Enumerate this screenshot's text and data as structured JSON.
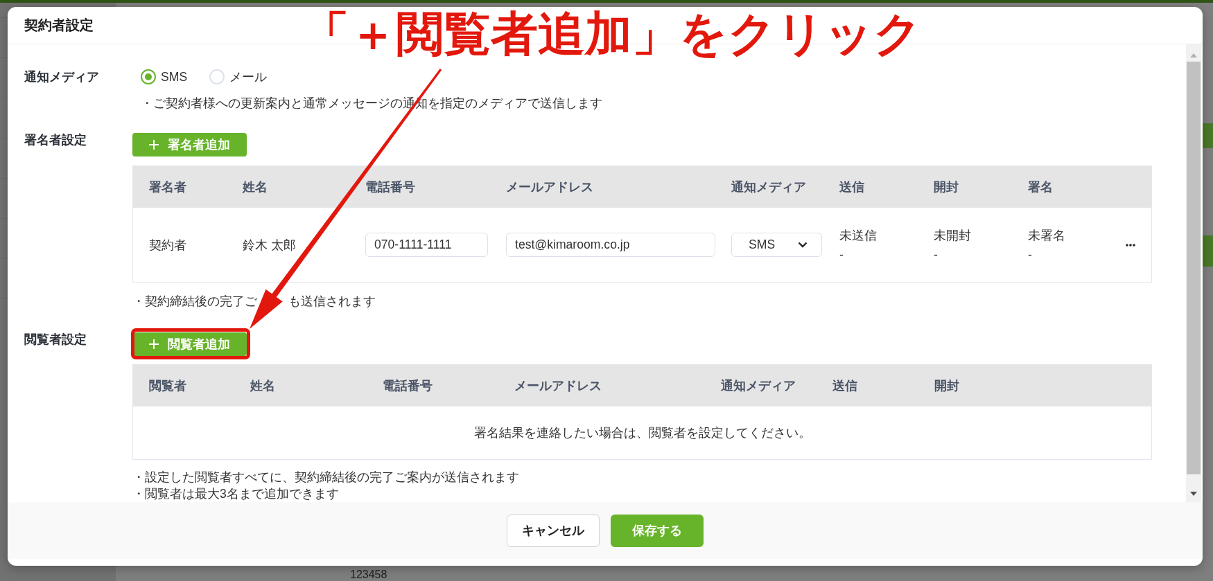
{
  "background_page": {
    "cell_text": "123458"
  },
  "dialog": {
    "title": "契約者設定"
  },
  "notification_media": {
    "label": "通知メディア",
    "options": [
      {
        "label": "SMS",
        "selected": true
      },
      {
        "label": "メール",
        "selected": false
      }
    ],
    "note": "・ご契約者様への更新案内と通常メッセージの通知を指定のメディアで送信します"
  },
  "signers": {
    "label": "署名者設定",
    "add_button": "署名者追加",
    "columns": [
      "署名者",
      "姓名",
      "電話番号",
      "メールアドレス",
      "通知メディア",
      "送信",
      "開封",
      "署名"
    ],
    "rows": [
      {
        "role": "契約者",
        "name": "鈴木 太郎",
        "phone": "070-1111-1111",
        "email": "test@kimaroom.co.jp",
        "media": "SMS",
        "statuses": [
          {
            "status": "未送信",
            "date": "-"
          },
          {
            "status": "未開封",
            "date": "-"
          },
          {
            "status": "未署名",
            "date": "-"
          }
        ]
      }
    ],
    "note": [
      "・契約締結後の完了ご",
      "も送信されます"
    ]
  },
  "viewers": {
    "label": "閲覧者設定",
    "add_button": "閲覧者追加",
    "highlighted": true,
    "columns": [
      "閲覧者",
      "姓名",
      "電話番号",
      "メールアドレス",
      "通知メディア",
      "送信",
      "開封"
    ],
    "empty_message": "署名結果を連絡したい場合は、閲覧者を設定してください。",
    "notes": [
      "・設定した閲覧者すべてに、契約締結後の完了ご案内が送信されます",
      "・閲覧者は最大3名まで追加できます"
    ]
  },
  "footer": {
    "buttons": [
      {
        "label": "キャンセル",
        "kind": "secondary"
      },
      {
        "label": "保存する",
        "kind": "primary"
      }
    ]
  },
  "annotation": {
    "text": "「＋閲覧者追加」をクリック"
  }
}
